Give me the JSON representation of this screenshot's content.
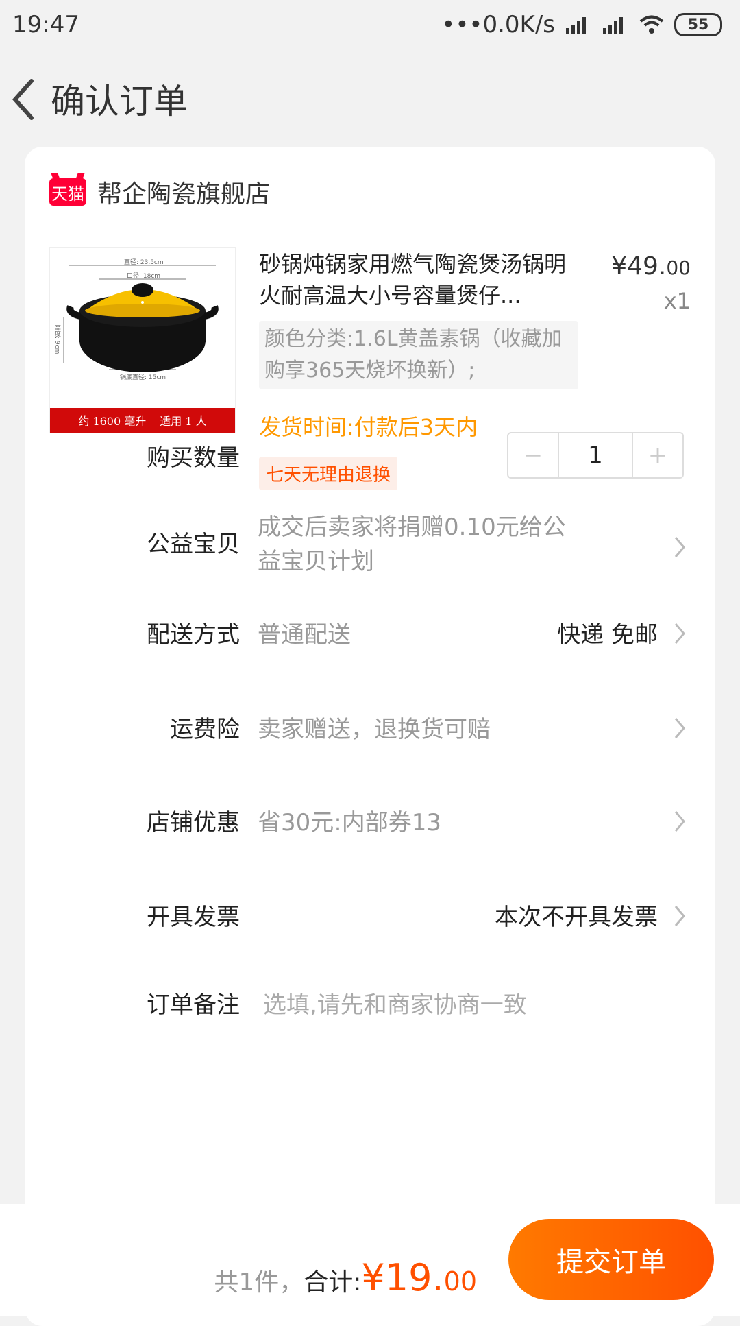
{
  "status_bar": {
    "time": "19:47",
    "network_speed": "•••0.0K/s",
    "battery": "55"
  },
  "header": {
    "back_icon": "chevron-left-icon",
    "title": "确认订单"
  },
  "shop": {
    "badge": "天猫",
    "name": "帮企陶瓷旗舰店"
  },
  "product": {
    "image_labels": {
      "diameter": "直径: 23.5cm",
      "mouth": "口径: 18cm",
      "height": "高度: 9cm",
      "bottom": "锅底直径: 15cm",
      "capacity": "约 1600 毫升",
      "people": "适用 1 人"
    },
    "title": "砂锅炖锅家用燃气陶瓷煲汤锅明火耐高温大小号容量煲仔...",
    "price_main": "¥49.",
    "price_decimal": "00",
    "quantity": "x1",
    "sku": "颜色分类:1.6L黄盖素锅（收藏加购享365天烧坏换新）;",
    "ship_time": "发货时间:付款后3天内",
    "tag": "七天无理由退换"
  },
  "rows": {
    "quantity": {
      "label": "购买数量",
      "minus": "−",
      "value": "1",
      "plus": "+"
    },
    "charity": {
      "label": "公益宝贝",
      "value": "成交后卖家将捐赠0.10元给公益宝贝计划"
    },
    "delivery": {
      "label": "配送方式",
      "value": "普通配送",
      "right": "快递 免邮"
    },
    "insurance": {
      "label": "运费险",
      "value": "卖家赠送，退换货可赔"
    },
    "discount": {
      "label": "店铺优惠",
      "value": "省30元:内部券13"
    },
    "invoice": {
      "label": "开具发票",
      "right": "本次不开具发票"
    },
    "note": {
      "label": "订单备注",
      "placeholder": "选填,请先和商家协商一致"
    }
  },
  "bottom_bar": {
    "count": "共1件，",
    "sum_label": "合计:",
    "amount_main": "¥19.",
    "amount_decimal": "00",
    "submit_label": "提交订单"
  },
  "colors": {
    "accent": "#ff5000",
    "ship": "#ff9800",
    "tmall": "#ff0036"
  }
}
